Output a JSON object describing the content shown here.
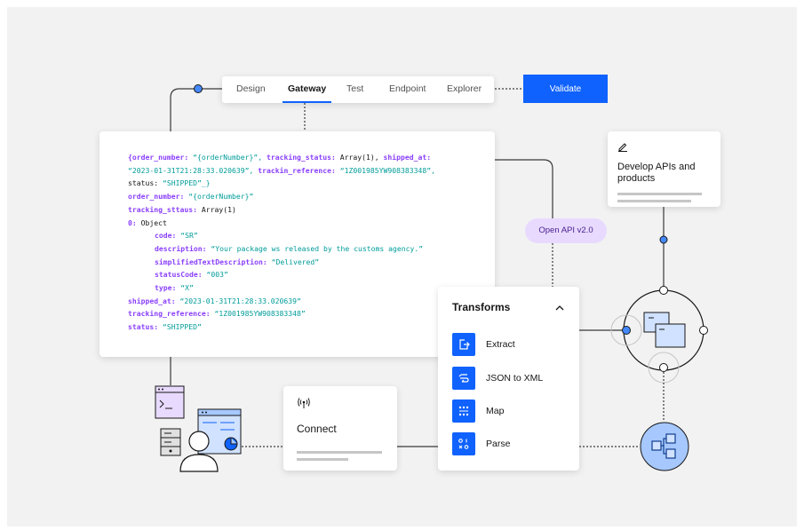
{
  "tabs": [
    "Design",
    "Gateway",
    "Test",
    "Endpoint",
    "Explorer"
  ],
  "active_tab": "Gateway",
  "validate_label": "Validate",
  "open_api_label": "Open API v2.0",
  "develop_card": {
    "title": "Develop APIs and products"
  },
  "connect_card": {
    "title": "Connect"
  },
  "transforms": {
    "title": "Transforms",
    "items": [
      "Extract",
      "JSON to XML",
      "Map",
      "Parse"
    ]
  },
  "code": {
    "line1_key1": "{order_number:",
    "line1_val1": " “{orderNumber}”,",
    "line1_key2": " tracking_status:",
    "line1_val2": " Array(1),",
    "line1_key3": " shipped_at:",
    "line2_val": "“2023-01-31T21:28:33.020639”,",
    "line2_key": " trackin_reference:",
    "line2_val2": " “1Z001985YW908383348”,",
    "line3_key": "status:",
    "line3_val": " “SHIPPED”_}",
    "line4_key": "order_number:",
    "line4_val": " “{orderNumber}”",
    "line5_key": "tracking_sttaus:",
    "line5_val": " Array(1)",
    "line6_key": "0:",
    "line6_val": " Object",
    "line7_key": "code:",
    "line7_val": " “SR”",
    "line8_key": "description:",
    "line8_val": " “Your package ws released by the customs agency.”",
    "line9_key": "simplifiedTextDescription:",
    "line9_val": " “Delivered”",
    "line10_key": "statusCode:",
    "line10_val": " “003”",
    "line11_key": "type:",
    "line11_val": " “X”",
    "line12_key": "shipped_at:",
    "line12_val": " “2023-01-31T21:28:33.020639”",
    "line13_key": "tracking_reference:",
    "line13_val": " “1Z001985YW908383348”",
    "line14_key": "status:",
    "line14_val": " “SHIPPED”"
  },
  "colors": {
    "accent": "#0f62fe",
    "code_key": "#8a3ffc",
    "code_string": "#009d9a",
    "pill_bg": "#e8daff",
    "node_fill": "#d0e2ff"
  },
  "icons": [
    "edit-icon",
    "chevron-up-icon",
    "extract-icon",
    "json-to-xml-icon",
    "map-icon",
    "parse-icon",
    "wireless-icon",
    "terminal-icon",
    "server-icon",
    "user-icon",
    "dashboard-icon",
    "windows-icon",
    "modules-icon"
  ]
}
